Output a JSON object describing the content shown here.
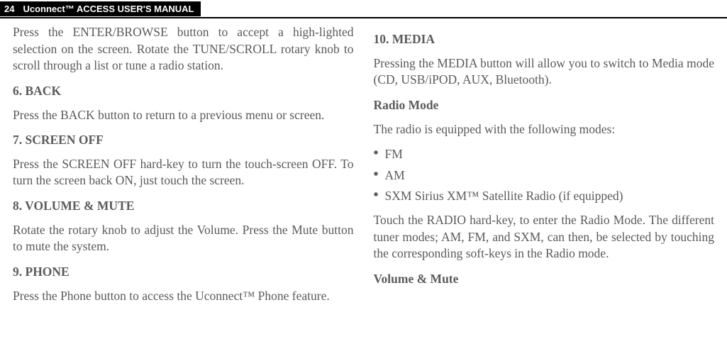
{
  "header": {
    "page_number": "24",
    "manual_title": "Uconnect™ ACCESS USER'S MANUAL"
  },
  "left": {
    "para1": "Press the ENTER/BROWSE button to accept a  high-lighted selection on the screen. Rotate the TUNE/SCROLL rotary knob to scroll through a list or tune a radio station.",
    "h6": "6. BACK",
    "para2": "Press the BACK button to return to a previous menu or screen.",
    "h7": "7. SCREEN OFF",
    "para3": "Press the SCREEN OFF hard-key to turn the touch-screen OFF. To turn the screen back ON, just touch the screen.",
    "h8": "8. VOLUME & MUTE",
    "para4": "Rotate the rotary knob to adjust the Volume. Press the Mute button to mute the system.",
    "h9": "9. PHONE",
    "para5": "Press the Phone button to access the Uconnect™ Phone feature."
  },
  "right": {
    "h10": "10. MEDIA",
    "para1": "Pressing the MEDIA button will allow you to switch to Media mode (CD, USB/iPOD, AUX, Bluetooth).",
    "hRadio": "Radio Mode",
    "para2": "The radio is equipped with the following modes:",
    "bullets": {
      "b1": "FM",
      "b2": "AM",
      "b3": "SXM Sirius XM™ Satellite Radio (if equipped)"
    },
    "para3": "Touch the RADIO hard-key, to enter the Radio Mode. The different tuner modes; AM, FM, and SXM, can then, be selected by touching the corresponding soft-keys in the Radio mode.",
    "hVolume": "Volume & Mute"
  }
}
